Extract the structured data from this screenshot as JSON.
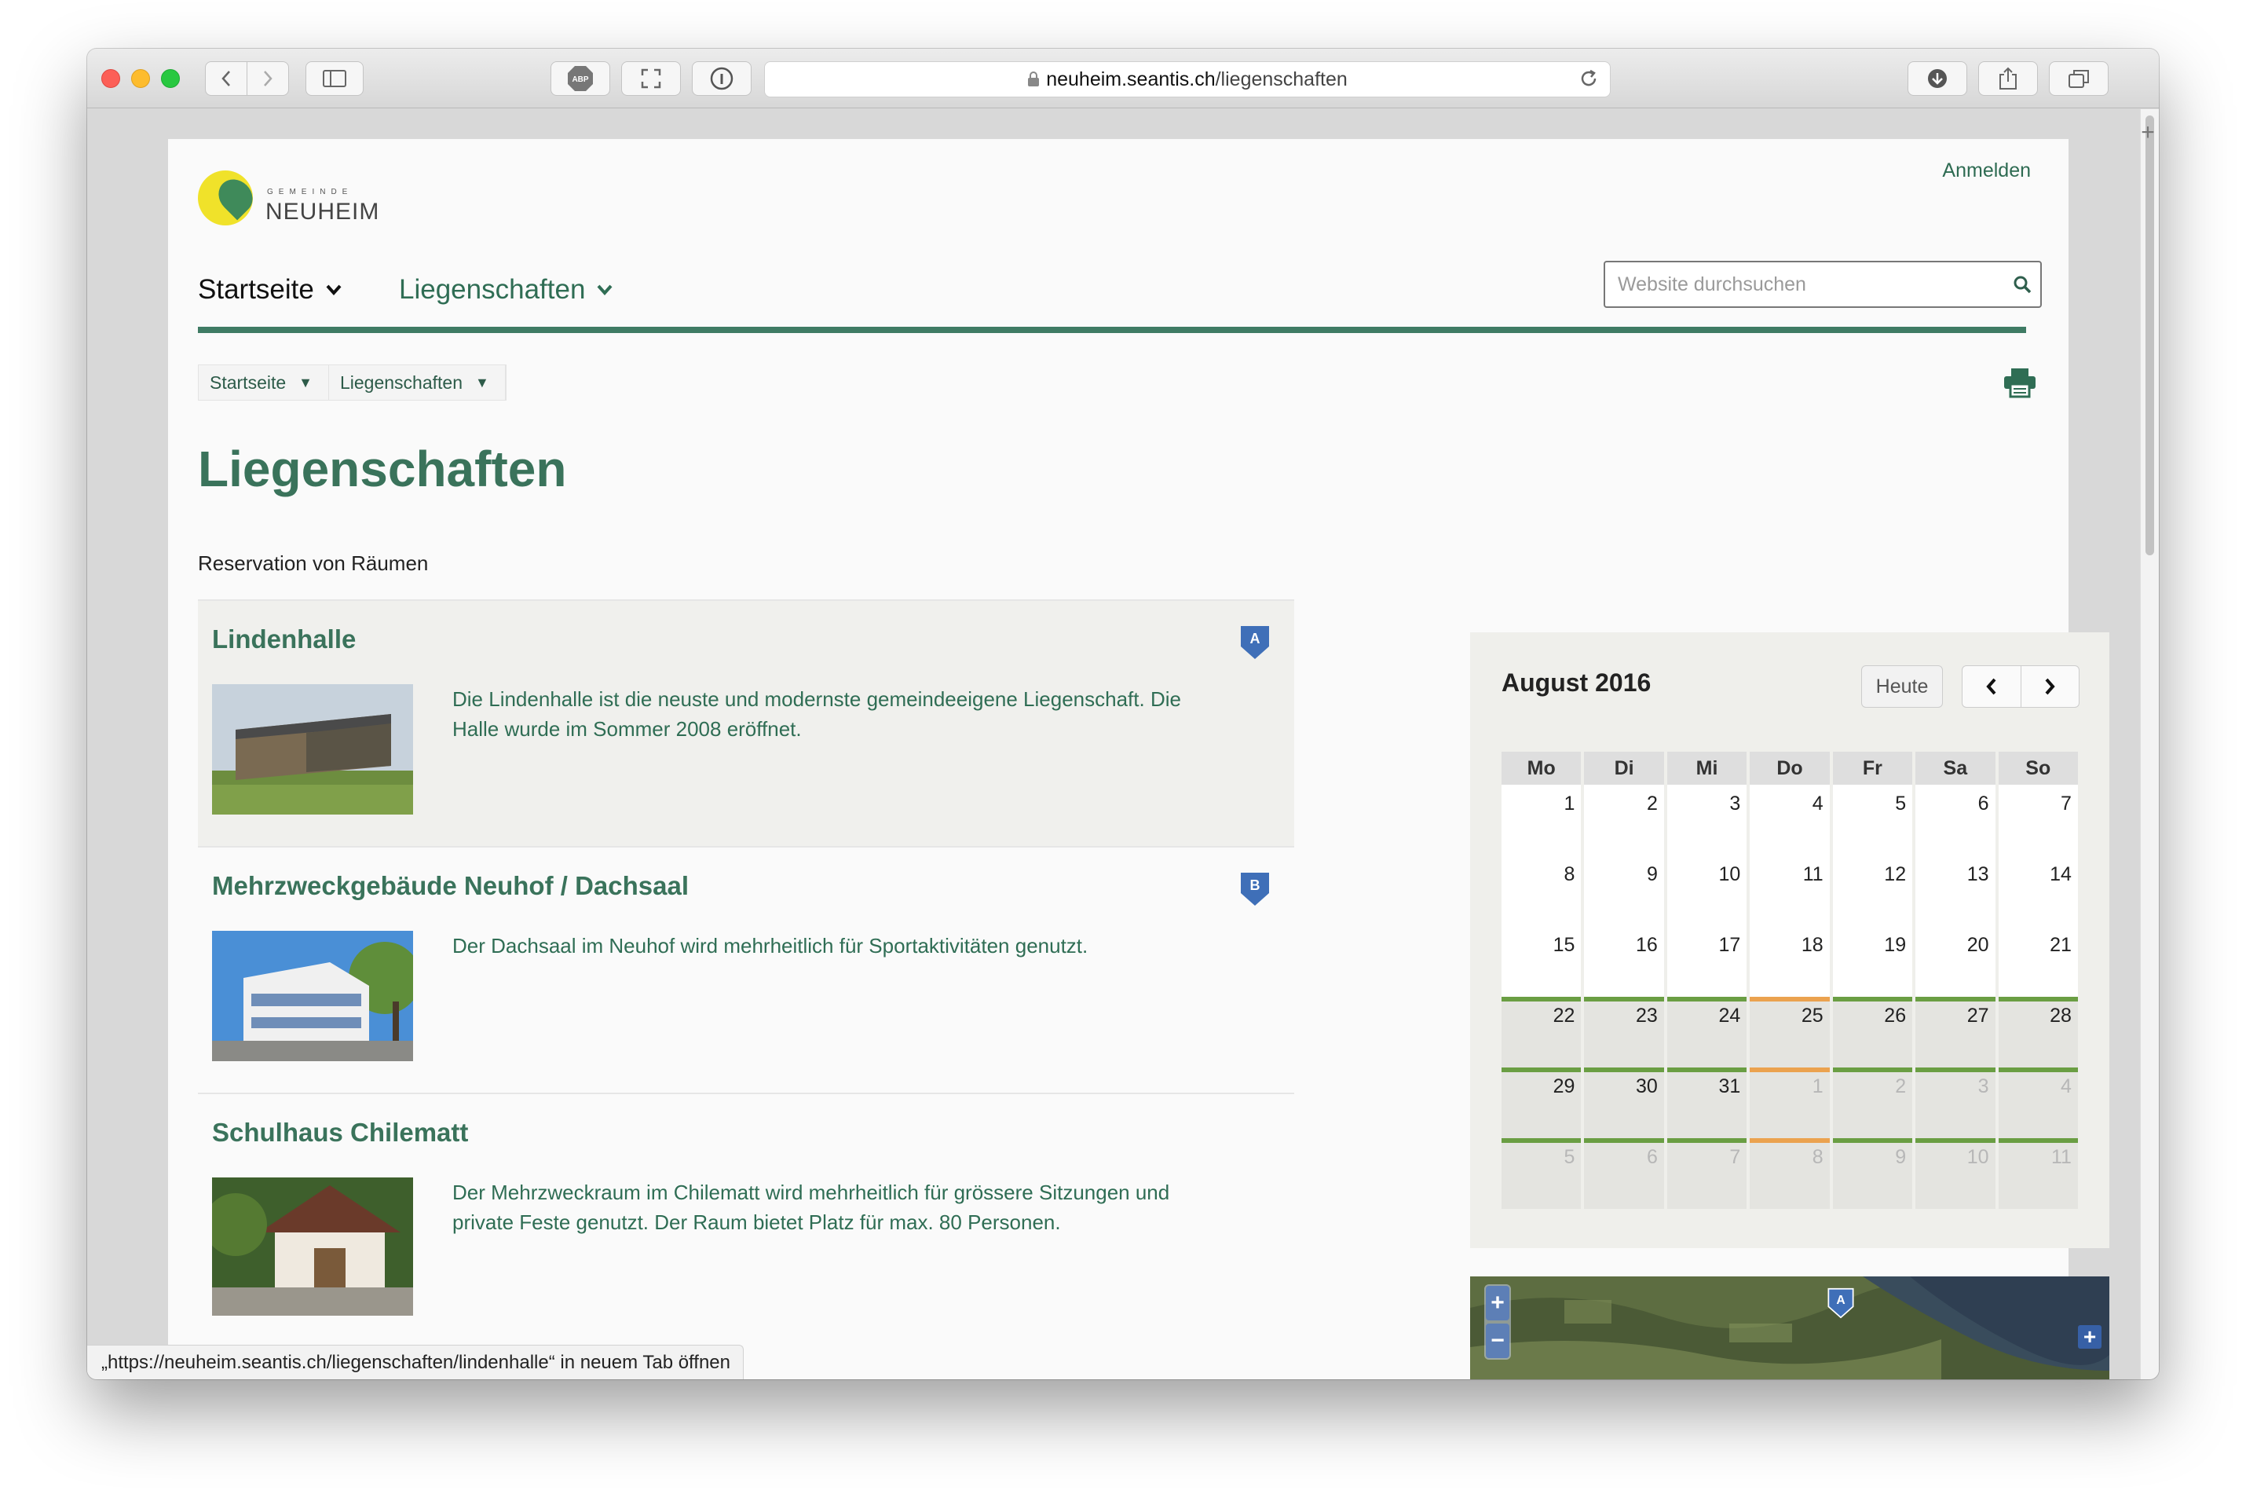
{
  "browser": {
    "url_host": "neuheim.seantis.ch",
    "url_path": "/liegenschaften",
    "status_text_prefix": "„https://neuheim.seantis.ch",
    "status_text_path": "/liegenschaften/lindenhalle",
    "status_text_suffix": "“ in neuem Tab öffnen"
  },
  "header": {
    "logo_small": "GEMEINDE",
    "logo_name": "NEUHEIM",
    "login": "Anmelden",
    "nav": [
      {
        "label": "Startseite",
        "color": "#111111"
      },
      {
        "label": "Liegenschaften",
        "color": "#2f6d54"
      }
    ],
    "search_placeholder": "Website durchsuchen"
  },
  "breadcrumb": [
    "Startseite",
    "Liegenschaften"
  ],
  "page": {
    "title": "Liegenschaften",
    "subtitle": "Reservation von Räumen"
  },
  "items": [
    {
      "title": "Lindenhalle",
      "marker": "A",
      "desc": "Die Lindenhalle ist die neuste und modernste gemeindeeigene Liegenschaft. Die Halle wurde im Sommer 2008 eröffnet."
    },
    {
      "title": "Mehrzweckgebäude Neuhof / Dachsaal",
      "marker": "B",
      "desc": "Der Dachsaal im Neuhof wird mehrheitlich für Sportaktivitäten genutzt."
    },
    {
      "title": "Schulhaus Chilematt",
      "marker": "",
      "desc": "Der Mehrzweckraum im Chilematt wird mehrheitlich für grössere Sitzungen und private Feste genutzt. Der Raum bietet Platz für max. 80 Personen."
    }
  ],
  "calendar": {
    "month": "August 2016",
    "today": "Heute",
    "weekdays": [
      "Mo",
      "Di",
      "Mi",
      "Do",
      "Fr",
      "Sa",
      "So"
    ],
    "weeks": [
      [
        "1",
        "2",
        "3",
        "4",
        "5",
        "6",
        "7"
      ],
      [
        "8",
        "9",
        "10",
        "11",
        "12",
        "13",
        "14"
      ],
      [
        "15",
        "16",
        "17",
        "18",
        "19",
        "20",
        "21"
      ],
      [
        "22",
        "23",
        "24",
        "25",
        "26",
        "27",
        "28"
      ],
      [
        "29",
        "30",
        "31",
        "1",
        "2",
        "3",
        "4"
      ],
      [
        "5",
        "6",
        "7",
        "8",
        "9",
        "10",
        "11"
      ]
    ],
    "status_colors": {
      "available": "#6a9e43",
      "partial": "#eba24f"
    }
  },
  "map": {
    "marker": "A"
  }
}
